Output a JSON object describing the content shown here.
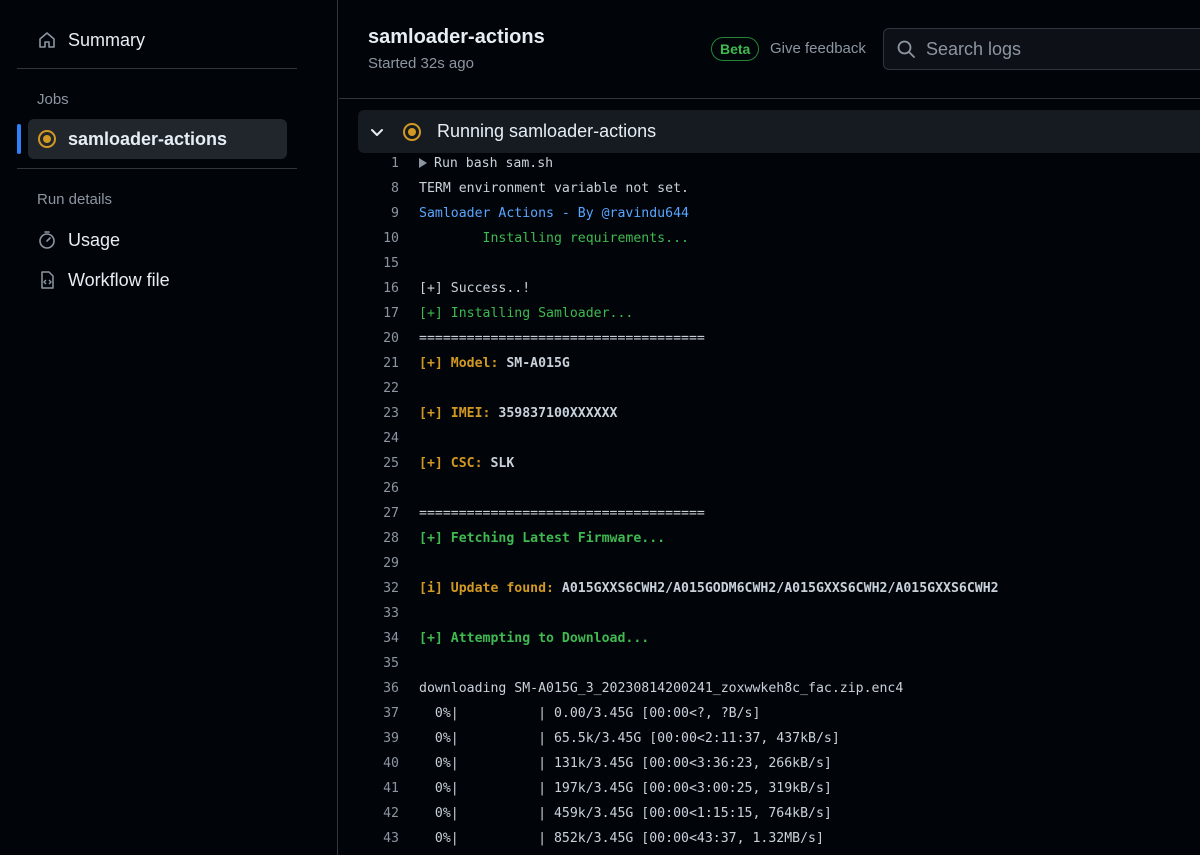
{
  "sidebar": {
    "summary_label": "Summary",
    "jobs_heading": "Jobs",
    "active_job_label": "samloader-actions",
    "run_details_heading": "Run details",
    "usage_label": "Usage",
    "workflow_label": "Workflow file"
  },
  "header": {
    "title": "samloader-actions",
    "subtitle": "Started 32s ago",
    "beta_label": "Beta",
    "feedback_label": "Give feedback",
    "search_placeholder": "Search logs"
  },
  "step": {
    "title": "Running samloader-actions"
  },
  "log": {
    "lines": [
      {
        "n": "1",
        "t": "Run bash sam.sh"
      },
      {
        "n": "8",
        "t": "TERM environment variable not set."
      },
      {
        "n": "9",
        "t": "Samloader Actions - By @ravindu644"
      },
      {
        "n": "10",
        "t": "        Installing requirements..."
      },
      {
        "n": "15",
        "t": ""
      },
      {
        "n": "16",
        "t": "[+] Success..!"
      },
      {
        "n": "17",
        "t": "[+] Installing Samloader..."
      },
      {
        "n": "20",
        "t": "===================================="
      },
      {
        "n": "21",
        "a": "[+] Model: ",
        "b": "SM-A015G"
      },
      {
        "n": "22",
        "t": ""
      },
      {
        "n": "23",
        "a": "[+] IMEI: ",
        "b": "359837100XXXXXX"
      },
      {
        "n": "24",
        "t": ""
      },
      {
        "n": "25",
        "a": "[+] CSC: ",
        "b": "SLK"
      },
      {
        "n": "26",
        "t": ""
      },
      {
        "n": "27",
        "t": "===================================="
      },
      {
        "n": "28",
        "t": "[+] Fetching Latest Firmware..."
      },
      {
        "n": "29",
        "t": ""
      },
      {
        "n": "32",
        "a": "[i] Update found: ",
        "b": "A015GXXS6CWH2/A015GODM6CWH2/A015GXXS6CWH2/A015GXXS6CWH2"
      },
      {
        "n": "33",
        "t": ""
      },
      {
        "n": "34",
        "t": "[+] Attempting to Download..."
      },
      {
        "n": "35",
        "t": ""
      },
      {
        "n": "36",
        "t": "downloading SM-A015G_3_20230814200241_zoxwwkeh8c_fac.zip.enc4"
      },
      {
        "n": "37",
        "t": "  0%|          | 0.00/3.45G [00:00<?, ?B/s]"
      },
      {
        "n": "39",
        "t": "  0%|          | 65.5k/3.45G [00:00<2:11:37, 437kB/s]"
      },
      {
        "n": "40",
        "t": "  0%|          | 131k/3.45G [00:00<3:36:23, 266kB/s]"
      },
      {
        "n": "41",
        "t": "  0%|          | 197k/3.45G [00:00<3:00:25, 319kB/s]"
      },
      {
        "n": "42",
        "t": "  0%|          | 459k/3.45G [00:00<1:15:15, 764kB/s]"
      },
      {
        "n": "43",
        "t": "  0%|          | 852k/3.45G [00:00<43:37, 1.32MB/s]"
      }
    ]
  },
  "icons": {
    "summary": "home-icon",
    "job_status": "in-progress-icon",
    "usage": "stopwatch-icon",
    "workflow": "file-code-icon",
    "search": "search-icon",
    "collapse": "chevron-down-icon"
  },
  "colors": {
    "accent": "#2f81f7",
    "in_progress": "#d29922",
    "success": "#3fb950",
    "link": "#58a6ff"
  }
}
